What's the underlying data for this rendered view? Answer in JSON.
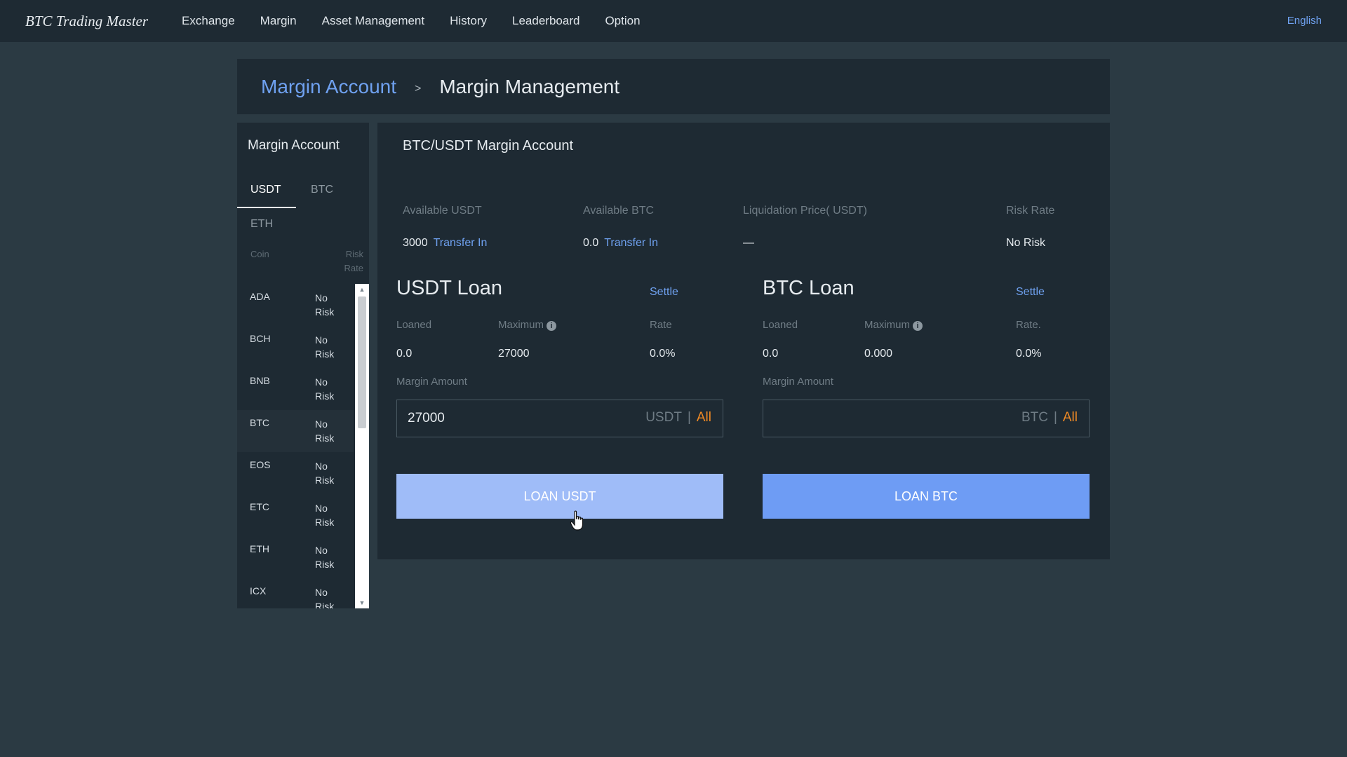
{
  "nav": {
    "brand": "BTC Trading Master",
    "items": [
      "Exchange",
      "Margin",
      "Asset Management",
      "History",
      "Leaderboard",
      "Option"
    ],
    "language": "English"
  },
  "breadcrumb": {
    "parent": "Margin Account",
    "separator": ">",
    "current": "Margin Management"
  },
  "sidebar": {
    "title": "Margin Account",
    "tabs": [
      "USDT",
      "BTC",
      "ETH"
    ],
    "active_tab": "USDT",
    "col_coin": "Coin",
    "col_risk_line1": "Risk",
    "col_risk_line2": "Rate",
    "coins": [
      {
        "name": "ADA",
        "risk1": "No",
        "risk2": "Risk"
      },
      {
        "name": "BCH",
        "risk1": "No",
        "risk2": "Risk"
      },
      {
        "name": "BNB",
        "risk1": "No",
        "risk2": "Risk"
      },
      {
        "name": "BTC",
        "risk1": "No",
        "risk2": "Risk"
      },
      {
        "name": "EOS",
        "risk1": "No",
        "risk2": "Risk"
      },
      {
        "name": "ETC",
        "risk1": "No",
        "risk2": "Risk"
      },
      {
        "name": "ETH",
        "risk1": "No",
        "risk2": "Risk"
      },
      {
        "name": "ICX",
        "risk1": "No",
        "risk2": "Risk"
      }
    ]
  },
  "main": {
    "title": "BTC/USDT Margin Account",
    "stats": {
      "available_usdt_label": "Available USDT",
      "available_usdt_value": "3000",
      "available_btc_label": "Available BTC",
      "available_btc_value": "0.0",
      "transfer_in": "Transfer In",
      "liquidation_label": "Liquidation Price( USDT)",
      "liquidation_value": "—",
      "risk_rate_label": "Risk Rate",
      "risk_rate_value": "No Risk"
    },
    "usdt_loan": {
      "title": "USDT Loan",
      "settle": "Settle",
      "loaned_label": "Loaned",
      "maximum_label": "Maximum",
      "rate_label": "Rate",
      "loaned_value": "0.0",
      "maximum_value": "27000",
      "rate_value": "0.0%",
      "margin_amount_label": "Margin Amount",
      "amount_value": "27000",
      "unit": "USDT",
      "all": "All",
      "button": "LOAN USDT"
    },
    "btc_loan": {
      "title": "BTC Loan",
      "settle": "Settle",
      "loaned_label": "Loaned",
      "maximum_label": "Maximum",
      "rate_label": "Rate.",
      "loaned_value": "0.0",
      "maximum_value": "0.000",
      "rate_value": "0.0%",
      "margin_amount_label": "Margin Amount",
      "amount_value": "",
      "unit": "BTC",
      "all": "All",
      "button": "LOAN BTC"
    }
  },
  "colors": {
    "background": "#2b3a43",
    "panel": "#1e2a33",
    "link": "#6fa1f0",
    "accent_orange": "#f08a24",
    "button_hover": "#9fbcf8",
    "button": "#6e9cf4"
  }
}
